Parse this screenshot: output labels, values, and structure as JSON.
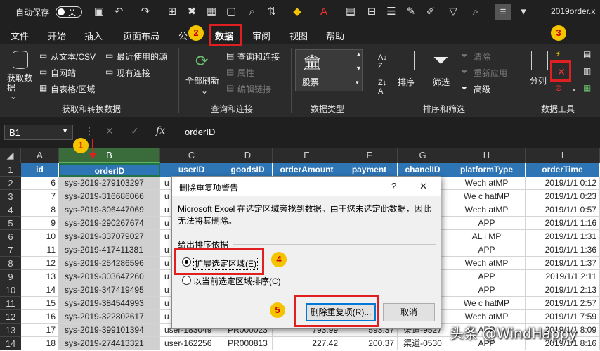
{
  "titlebar": {
    "autosave_label": "自动保存",
    "autosave_state": "关",
    "filename": "2019order.x"
  },
  "tabs": [
    "文件",
    "开始",
    "插入",
    "页面布局",
    "公",
    "数据",
    "审阅",
    "视图",
    "帮助"
  ],
  "ribbon": {
    "get_data": "获取数\n据",
    "from_text": "从文本/CSV",
    "from_web": "自网站",
    "from_table": "自表格/区域",
    "recent_sources": "最近使用的源",
    "existing_conn": "现有连接",
    "group_get": "获取和转换数据",
    "refresh_all": "全部刷新",
    "queries_conn": "查询和连接",
    "properties": "属性",
    "edit_links": "编辑链接",
    "group_queries": "查询和连接",
    "stocks": "股票",
    "group_types": "数据类型",
    "sort": "排序",
    "filter": "筛选",
    "clear": "清除",
    "reapply": "重新应用",
    "advanced": "高级",
    "group_sort": "排序和筛选",
    "text_to_cols": "分列",
    "group_tools": "数据工具"
  },
  "formula_bar": {
    "name_box": "B1",
    "fx": "fx",
    "content": "orderID"
  },
  "columns": [
    "A",
    "B",
    "C",
    "D",
    "E",
    "F",
    "G",
    "H",
    "I"
  ],
  "headers": [
    "id",
    "orderID",
    "userID",
    "goodsID",
    "orderAmount",
    "payment",
    "chanelID",
    "platformType",
    "orderTime"
  ],
  "rows": [
    {
      "n": "2",
      "a": "6",
      "b": "sys-2019-279103297",
      "c": "u",
      "g": "5",
      "h": "Wech atMP",
      "i": "2019/1/1 0:12"
    },
    {
      "n": "3",
      "a": "7",
      "b": "sys-2019-316686066",
      "c": "u",
      "g": "5",
      "h": "We c hatMP",
      "i": "2019/1/1 0:23"
    },
    {
      "n": "4",
      "a": "8",
      "b": "sys-2019-306447069",
      "c": "u",
      "g": "6",
      "h": "Wech atMP",
      "i": "2019/1/1 0:57"
    },
    {
      "n": "5",
      "a": "9",
      "b": "sys-2019-290267674",
      "c": "u",
      "g": "0",
      "h": "APP",
      "i": "2019/1/1 1:16"
    },
    {
      "n": "6",
      "a": "10",
      "b": "sys-2019-337079027",
      "c": "u",
      "g": "0",
      "h": "AL i MP",
      "i": "2019/1/1 1:31"
    },
    {
      "n": "7",
      "a": "11",
      "b": "sys-2019-417411381",
      "c": "u",
      "g": "7",
      "h": "APP",
      "i": "2019/1/1 1:36"
    },
    {
      "n": "8",
      "a": "12",
      "b": "sys-2019-254286596",
      "c": "u",
      "g": "1",
      "h": "Wech atMP",
      "i": "2019/1/1 1:37"
    },
    {
      "n": "9",
      "a": "13",
      "b": "sys-2019-303647260",
      "c": "u",
      "g": "4",
      "h": "APP",
      "i": "2019/1/1 2:11"
    },
    {
      "n": "10",
      "a": "14",
      "b": "sys-2019-347419495",
      "c": "u",
      "g": "5",
      "h": "APP",
      "i": "2019/1/1 2:13"
    },
    {
      "n": "11",
      "a": "15",
      "b": "sys-2019-384544993",
      "c": "u",
      "g": "0",
      "h": "We c hatMP",
      "i": "2019/1/1 2:57"
    },
    {
      "n": "12",
      "a": "16",
      "b": "sys-2019-322802617",
      "c": "u",
      "g": "9",
      "h": "Wech atMP",
      "i": "2019/1/1 7:59"
    },
    {
      "n": "13",
      "a": "17",
      "b": "sys-2019-399101394",
      "c": "user-183049",
      "d": "PR000023",
      "e": "793.99",
      "f": "593.37",
      "g": "渠道-9527",
      "h": "APP",
      "i": "2019/1/1 8:09"
    },
    {
      "n": "14",
      "a": "18",
      "b": "sys-2019-274413321",
      "c": "user-162256",
      "d": "PR000813",
      "e": "227.42",
      "f": "200.37",
      "g": "渠道-0530",
      "h": "APP",
      "i": "2019/1/1 8:16"
    }
  ],
  "dialog": {
    "title": "删除重复项警告",
    "help": "?",
    "close": "✕",
    "message": "Microsoft Excel 在选定区域旁找到数据。由于您未选定此数据，因此无法将其删除。",
    "section": "给出排序依据",
    "opt_expand": "扩展选定区域(E)",
    "opt_current": "以当前选定区域排序(C)",
    "btn_remove": "删除重复项(R)...",
    "btn_cancel": "取消"
  },
  "annotations": [
    "1",
    "2",
    "3",
    "4",
    "5"
  ],
  "watermark": "头条 @WindHappy",
  "colors": {
    "accent_green": "#217346",
    "header_blue": "#2e75b6",
    "annotation_red": "#e02020",
    "badge_yellow": "#f5c400"
  }
}
